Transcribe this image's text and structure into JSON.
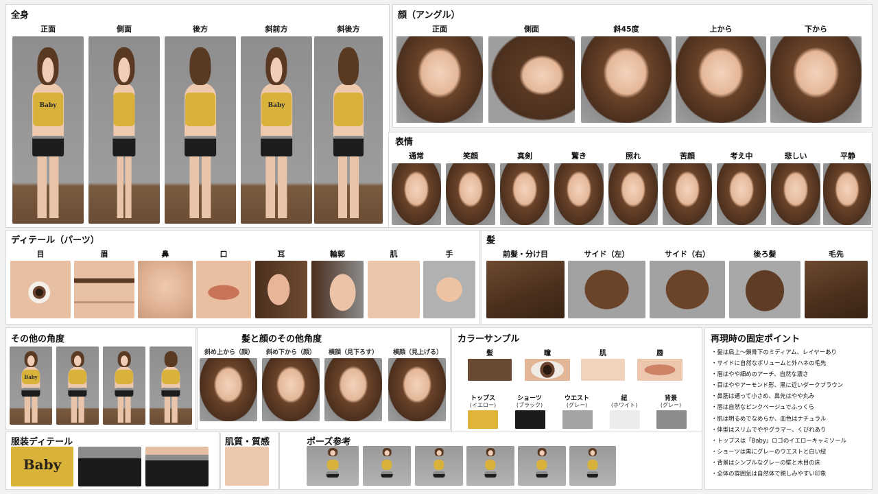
{
  "full_body": {
    "title": "全身",
    "labels": [
      "正面",
      "側面",
      "後方",
      "斜前方",
      "斜後方"
    ]
  },
  "face_angle": {
    "title": "顔（アングル）",
    "labels": [
      "正面",
      "側面",
      "斜45度",
      "上から",
      "下から"
    ]
  },
  "expressions": {
    "title": "表情",
    "labels": [
      "通常",
      "笑顔",
      "真剣",
      "驚き",
      "照れ",
      "苦顔",
      "考え中",
      "悲しい",
      "平静"
    ]
  },
  "details": {
    "title": "ディテール（パーツ）",
    "labels": [
      "目",
      "眉",
      "鼻",
      "口",
      "耳",
      "輪郭",
      "肌",
      "手"
    ]
  },
  "hair": {
    "title": "髪",
    "labels": [
      "前髪・分け目",
      "サイド（左）",
      "サイド（右）",
      "後ろ髪",
      "毛先"
    ]
  },
  "other_angles": {
    "title": "その他の角度"
  },
  "hair_face_angles": {
    "title": "髪と顔のその他角度",
    "labels": [
      "斜め上から（顔）",
      "斜め下から（顔）",
      "横顔（見下ろす）",
      "横顔（見上げる）"
    ]
  },
  "colors": {
    "title": "カラーサンプル",
    "row1": [
      {
        "label": "髪",
        "color": "#6b4a33"
      },
      {
        "label": "瞳",
        "color": "#4a2c1c"
      },
      {
        "label": "肌",
        "color": "#f0d2bd"
      },
      {
        "label": "唇",
        "color": "#d99a7e"
      }
    ],
    "row2": [
      {
        "label": "トップス",
        "sub": "(イエロー)",
        "color": "#e0b43c"
      },
      {
        "label": "ショーツ",
        "sub": "(ブラック)",
        "color": "#1a1a1a"
      },
      {
        "label": "ウエスト",
        "sub": "(グレー)",
        "color": "#a3a3a3"
      },
      {
        "label": "紐",
        "sub": "(ホワイト)",
        "color": "#ececec"
      },
      {
        "label": "背景",
        "sub": "(グレー)",
        "color": "#8c8c8c"
      }
    ]
  },
  "fixed_points": {
    "title": "再現時の固定ポイント",
    "items": [
      "・髪は肩上〜鎖骨下のミディアム、レイヤーあり",
      "・サイドに自然なボリュームと外ハネの毛先",
      "・眉はやや細めのアーチ、自然な濃さ",
      "・目はややアーモンド形、黒に近いダークブラウン",
      "・鼻筋は通って小さめ、鼻先はやや丸み",
      "・唇は自然なピンクベージュでふっくら",
      "・肌は明るめでなめらか、血色はナチュラル",
      "・体型はスリムでややグラマー、くびれあり",
      "・トップスは「Baby」ロゴのイエローキャミソール",
      "・ショーツは黒にグレーのウエストと白い紐",
      "・背景はシンプルなグレーの壁と木目の床",
      "・全体の雰囲気は自然体で親しみやすい印象"
    ]
  },
  "outfit": {
    "title": "服装ディテール",
    "logo": "Baby"
  },
  "skin": {
    "title": "肌質・質感"
  },
  "pose": {
    "title": "ポーズ参考"
  },
  "shirt_logo": "Baby"
}
